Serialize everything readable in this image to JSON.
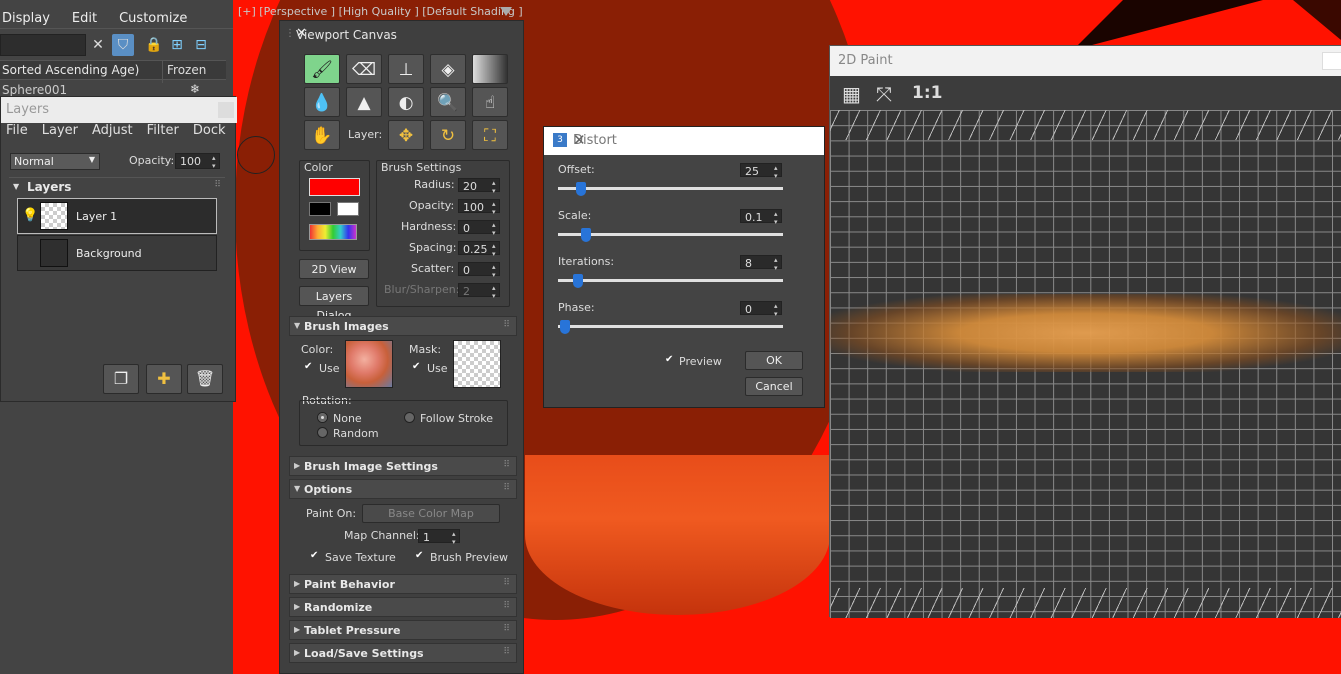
{
  "viewport": {
    "label": "[+] [Perspective ] [High Quality ] [Default Shading ]"
  },
  "scene_explorer": {
    "menu": [
      "Display",
      "Edit",
      "Customize"
    ],
    "columns": [
      "Sorted Ascending Age)",
      "Frozen"
    ],
    "row_name": "Sphere001",
    "row_frozen_icon": "❄"
  },
  "layers_panel": {
    "title": "Layers",
    "menu": [
      "File",
      "Layer",
      "Adjust",
      "Filter",
      "Dock"
    ],
    "blend_mode": "Normal",
    "opacity_label": "Opacity:",
    "opacity_value": "100",
    "section_title": "Layers",
    "layers": [
      {
        "name": "Layer 1"
      },
      {
        "name": "Background"
      }
    ]
  },
  "viewport_canvas": {
    "title": "Viewport Canvas",
    "layer_label": "Layer:",
    "color_group": "Color",
    "primary_color": "#ff0000",
    "brush_settings_group": "Brush Settings",
    "settings": [
      {
        "label": "Radius:",
        "value": "20"
      },
      {
        "label": "Opacity:",
        "value": "100"
      },
      {
        "label": "Hardness:",
        "value": "0"
      },
      {
        "label": "Spacing:",
        "value": "0.25"
      },
      {
        "label": "Scatter:",
        "value": "0"
      },
      {
        "label": "Blur/Sharpen:",
        "value": "2"
      }
    ],
    "view_2d_button": "2D View",
    "layers_dialog_button": "Layers Dialog",
    "brush_images": {
      "title": "Brush Images",
      "color_label": "Color:",
      "mask_label": "Mask:",
      "use_label": "Use",
      "rotation_label": "Rotation:",
      "none_label": "None",
      "follow_stroke_label": "Follow Stroke",
      "random_label": "Random"
    },
    "brush_image_settings_title": "Brush Image Settings",
    "options": {
      "title": "Options",
      "paint_on_label": "Paint On:",
      "paint_on_value": "Base Color Map",
      "map_channel_label": "Map Channel:",
      "map_channel_value": "1",
      "save_texture_label": "Save Texture",
      "brush_preview_label": "Brush Preview"
    },
    "rollouts": [
      "Paint Behavior",
      "Randomize",
      "Tablet Pressure",
      "Load/Save Settings"
    ]
  },
  "distort": {
    "title": "Distort",
    "params": [
      {
        "label": "Offset:",
        "value": "25",
        "position": 0.1
      },
      {
        "label": "Scale:",
        "value": "0.1",
        "position": 0.125
      },
      {
        "label": "Iterations:",
        "value": "8",
        "position": 0.09
      },
      {
        "label": "Phase:",
        "value": "0",
        "position": 0.03
      }
    ],
    "preview_label": "Preview",
    "ok_label": "OK",
    "cancel_label": "Cancel"
  },
  "paint_2d": {
    "title": "2D Paint",
    "zoom_label": "1:1"
  }
}
